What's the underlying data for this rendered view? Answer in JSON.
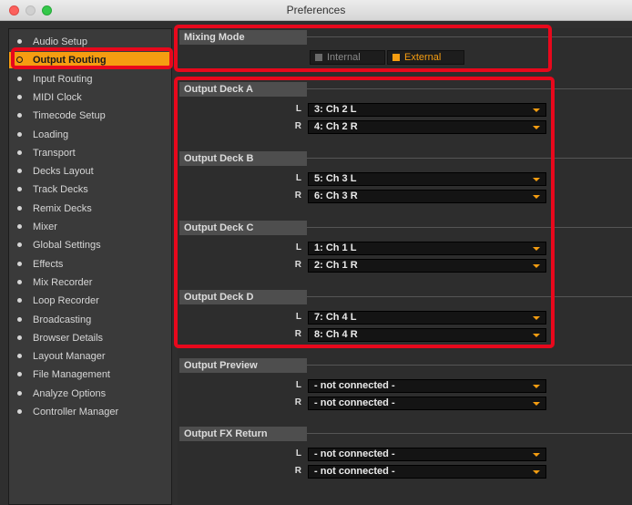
{
  "window": {
    "title": "Preferences"
  },
  "sidebar": {
    "items": [
      {
        "label": "Audio Setup",
        "active": false
      },
      {
        "label": "Output Routing",
        "active": true
      },
      {
        "label": "Input Routing",
        "active": false
      },
      {
        "label": "MIDI Clock",
        "active": false
      },
      {
        "label": "Timecode Setup",
        "active": false
      },
      {
        "label": "Loading",
        "active": false
      },
      {
        "label": "Transport",
        "active": false
      },
      {
        "label": "Decks Layout",
        "active": false
      },
      {
        "label": "Track Decks",
        "active": false
      },
      {
        "label": "Remix Decks",
        "active": false
      },
      {
        "label": "Mixer",
        "active": false
      },
      {
        "label": "Global Settings",
        "active": false
      },
      {
        "label": "Effects",
        "active": false
      },
      {
        "label": "Mix Recorder",
        "active": false
      },
      {
        "label": "Loop Recorder",
        "active": false
      },
      {
        "label": "Broadcasting",
        "active": false
      },
      {
        "label": "Browser Details",
        "active": false
      },
      {
        "label": "Layout Manager",
        "active": false
      },
      {
        "label": "File Management",
        "active": false
      },
      {
        "label": "Analyze Options",
        "active": false
      },
      {
        "label": "Controller Manager",
        "active": false
      }
    ]
  },
  "mixing_mode": {
    "title": "Mixing Mode",
    "internal_label": "Internal",
    "external_label": "External",
    "selected": "External"
  },
  "sections": [
    {
      "title": "Output Deck A",
      "l": "3: Ch 2 L",
      "r": "4: Ch 2 R"
    },
    {
      "title": "Output Deck B",
      "l": "5: Ch 3 L",
      "r": "6: Ch 3 R"
    },
    {
      "title": "Output Deck C",
      "l": "1: Ch 1 L",
      "r": "2: Ch 1 R"
    },
    {
      "title": "Output Deck D",
      "l": "7: Ch 4 L",
      "r": "8: Ch 4 R"
    },
    {
      "title": "Output Preview",
      "l": "- not connected -",
      "r": "- not connected -"
    },
    {
      "title": "Output FX Return",
      "l": "- not connected -",
      "r": "- not connected -"
    }
  ],
  "channel_labels": {
    "left": "L",
    "right": "R"
  },
  "colors": {
    "accent": "#f59d11",
    "highlight": "#e8081c",
    "panel": "#2d2d2d"
  }
}
